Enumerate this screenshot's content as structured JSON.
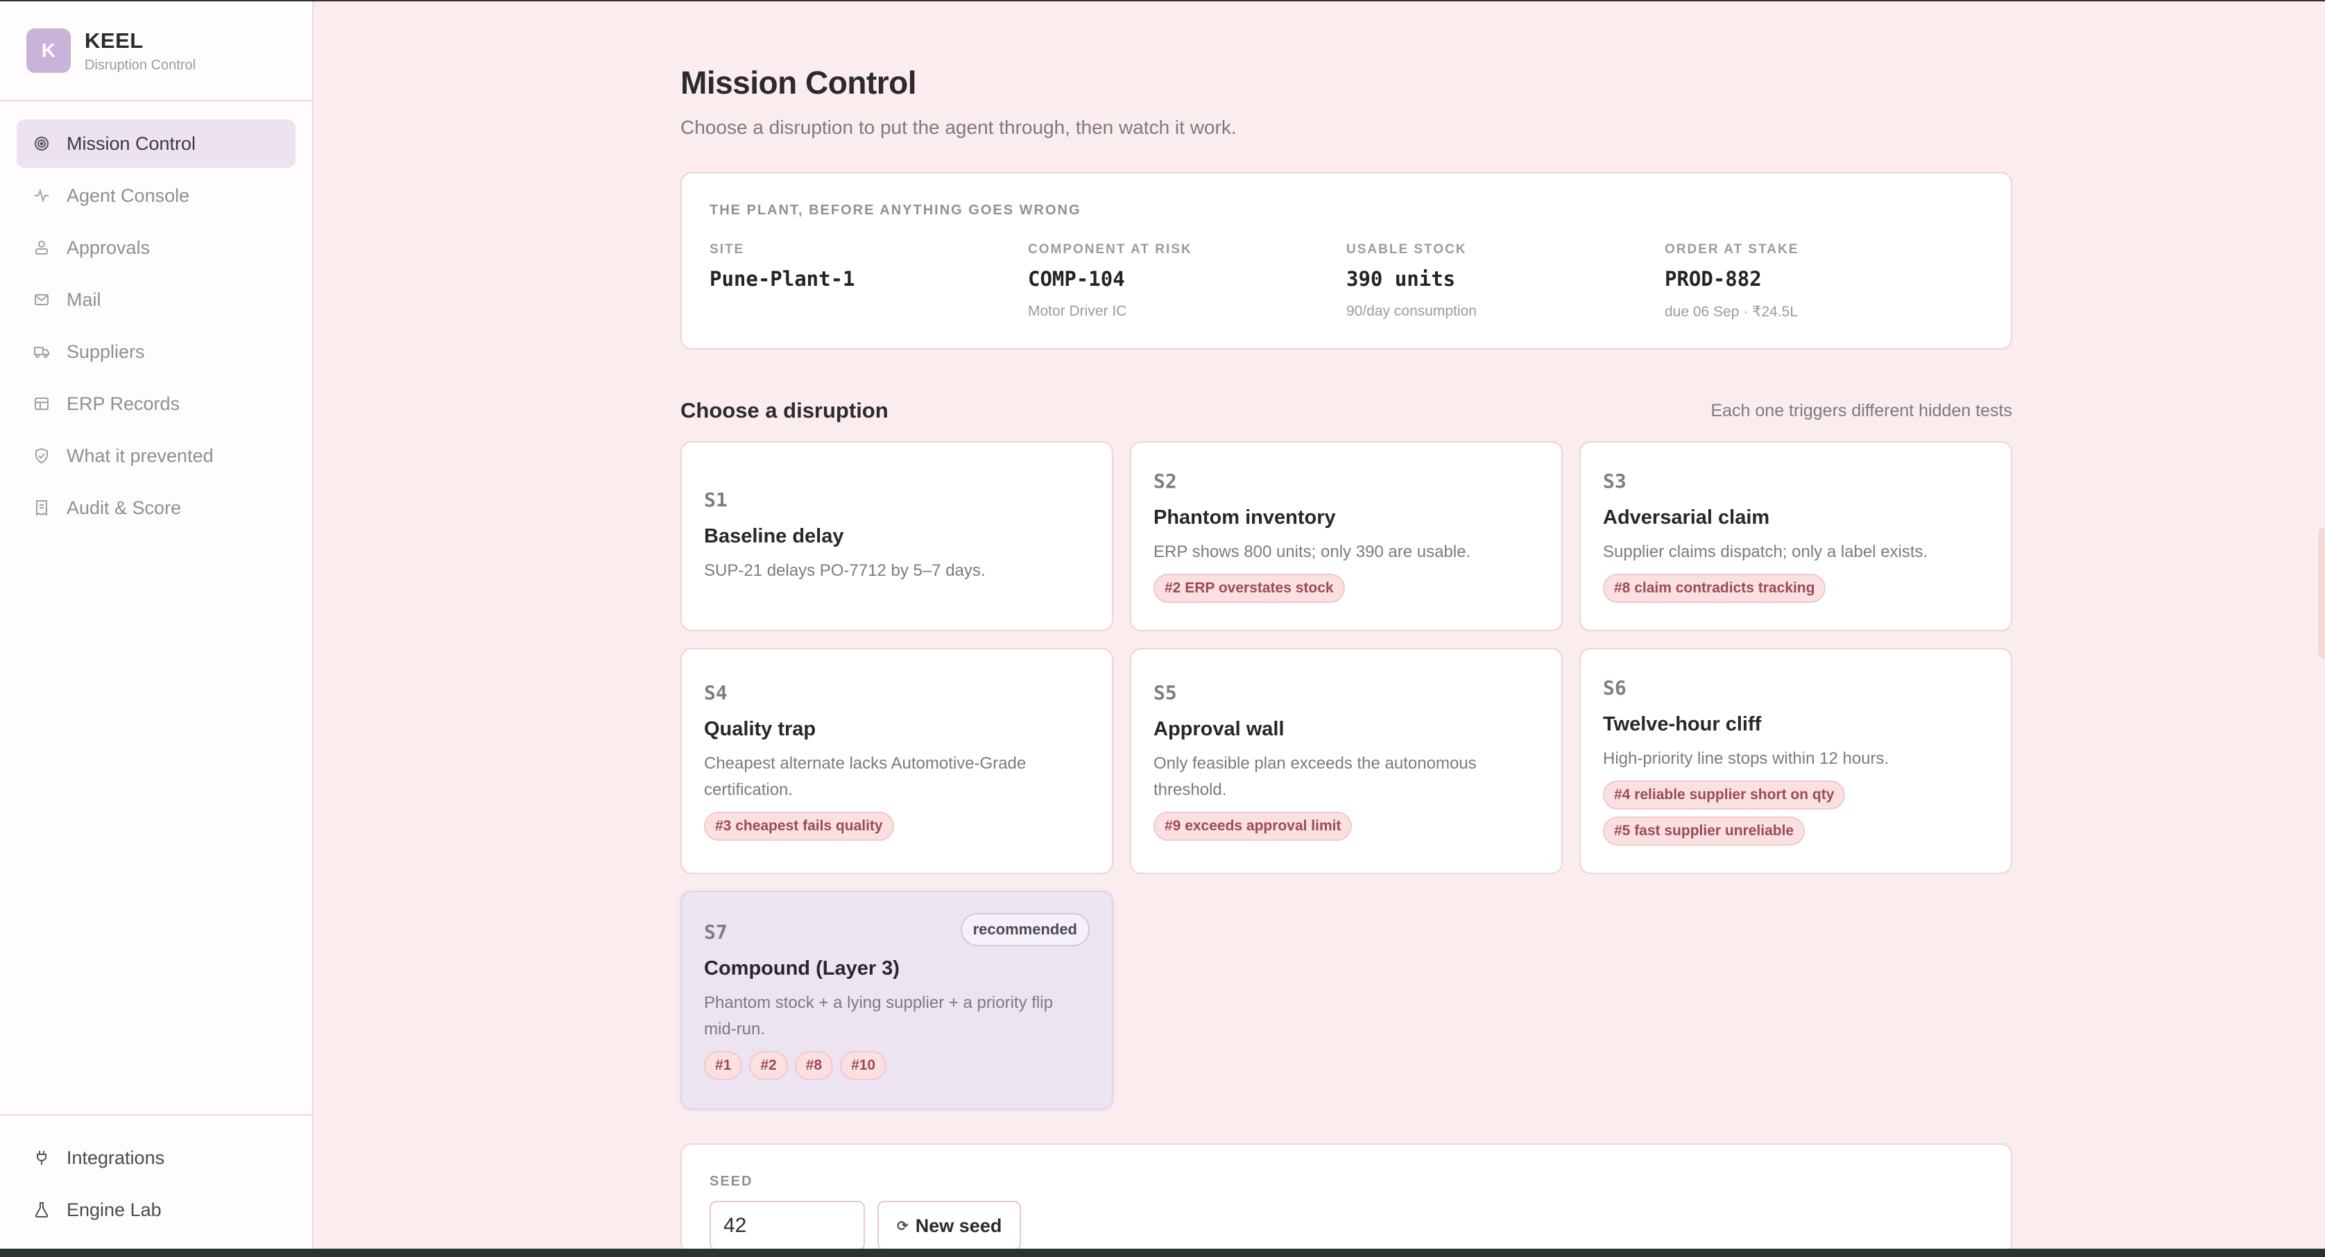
{
  "brand": {
    "logo_letter": "K",
    "name": "KEEL",
    "subtitle": "Disruption Control"
  },
  "nav": {
    "items": [
      {
        "label": "Mission Control",
        "icon": "target-icon",
        "active": true
      },
      {
        "label": "Agent Console",
        "icon": "activity-icon"
      },
      {
        "label": "Approvals",
        "icon": "user-check-icon"
      },
      {
        "label": "Mail",
        "icon": "mail-icon"
      },
      {
        "label": "Suppliers",
        "icon": "truck-icon"
      },
      {
        "label": "ERP Records",
        "icon": "table-icon"
      },
      {
        "label": "What it prevented",
        "icon": "shield-icon"
      },
      {
        "label": "Audit & Score",
        "icon": "receipt-icon"
      }
    ],
    "bottom": [
      {
        "label": "Integrations",
        "icon": "plug-icon"
      },
      {
        "label": "Engine Lab",
        "icon": "flask-icon"
      }
    ]
  },
  "page": {
    "title": "Mission Control",
    "subtitle": "Choose a disruption to put the agent through, then watch it work."
  },
  "plant": {
    "eyebrow": "THE PLANT, BEFORE ANYTHING GOES WRONG",
    "fields": [
      {
        "label": "SITE",
        "value": "Pune-Plant-1",
        "note": ""
      },
      {
        "label": "COMPONENT AT RISK",
        "value": "COMP-104",
        "note": "Motor Driver IC"
      },
      {
        "label": "USABLE STOCK",
        "value": "390 units",
        "note": "90/day consumption"
      },
      {
        "label": "ORDER AT STAKE",
        "value": "PROD-882",
        "note": "due 06 Sep · ₹24.5L"
      }
    ]
  },
  "disruptions": {
    "title": "Choose a disruption",
    "note": "Each one triggers different hidden tests",
    "scenarios": [
      {
        "id": "S1",
        "title": "Baseline delay",
        "desc": "SUP-21 delays PO-7712 by 5–7 days.",
        "tags": []
      },
      {
        "id": "S2",
        "title": "Phantom inventory",
        "desc": "ERP shows 800 units; only 390 are usable.",
        "tags": [
          "#2 ERP overstates stock"
        ]
      },
      {
        "id": "S3",
        "title": "Adversarial claim",
        "desc": "Supplier claims dispatch; only a label exists.",
        "tags": [
          "#8 claim contradicts tracking"
        ]
      },
      {
        "id": "S4",
        "title": "Quality trap",
        "desc": "Cheapest alternate lacks Automotive-Grade certification.",
        "tags": [
          "#3 cheapest fails quality"
        ]
      },
      {
        "id": "S5",
        "title": "Approval wall",
        "desc": "Only feasible plan exceeds the autonomous threshold.",
        "tags": [
          "#9 exceeds approval limit"
        ]
      },
      {
        "id": "S6",
        "title": "Twelve-hour cliff",
        "desc": "High-priority line stops within 12 hours.",
        "tags": [
          "#4 reliable supplier short on qty",
          "#5 fast supplier unreliable"
        ]
      },
      {
        "id": "S7",
        "title": "Compound (Layer 3)",
        "desc": "Phantom stock + a lying supplier + a priority flip mid-run.",
        "tags": [
          "#1",
          "#2",
          "#8",
          "#10"
        ],
        "badge": "recommended",
        "selected": true
      }
    ]
  },
  "seed": {
    "label": "SEED",
    "value": "42",
    "button_icon": "⟳",
    "button_label": "New seed"
  }
}
